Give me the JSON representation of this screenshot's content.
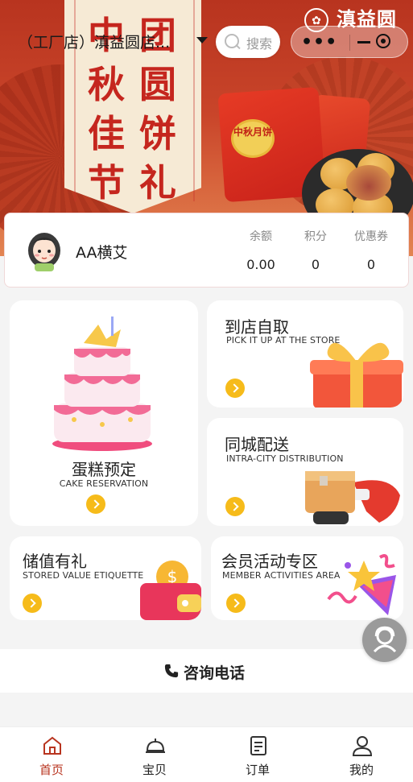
{
  "banner": {
    "promo_col1": "中秋佳节",
    "promo_col2": "团圆饼礼",
    "bag_badge": "中秋月饼",
    "logo": "滇益圆"
  },
  "header": {
    "store_name": "（工厂店）滇益圆店...",
    "search_placeholder": "搜索"
  },
  "member": {
    "name": "AA横艾",
    "stats": [
      {
        "label": "余额",
        "value": "0.00"
      },
      {
        "label": "积分",
        "value": "0"
      },
      {
        "label": "优惠券",
        "value": "0"
      }
    ]
  },
  "services": {
    "cake": {
      "title": "蛋糕预定",
      "subtitle": "CAKE RESERVATION"
    },
    "pickup": {
      "title": "到店自取",
      "subtitle": "PICK IT UP AT THE STORE"
    },
    "delivery": {
      "title": "同城配送",
      "subtitle": "INTRA-CITY DISTRIBUTION"
    },
    "stored_value": {
      "title": "储值有礼",
      "subtitle": "STORED VALUE ETIQUETTE"
    },
    "member_activity": {
      "title": "会员活动专区",
      "subtitle": "MEMBER ACTIVITIES AREA"
    }
  },
  "consult": {
    "label": "咨询电话",
    "icon": "phone-icon"
  },
  "tabs": [
    {
      "label": "首页",
      "icon": "home-icon",
      "active": true
    },
    {
      "label": "宝贝",
      "icon": "dome-icon",
      "active": false
    },
    {
      "label": "订单",
      "icon": "order-icon",
      "active": false
    },
    {
      "label": "我的",
      "icon": "user-icon",
      "active": false
    }
  ],
  "colors": {
    "brand": "#b8341f",
    "accent": "#f6bb1a"
  }
}
